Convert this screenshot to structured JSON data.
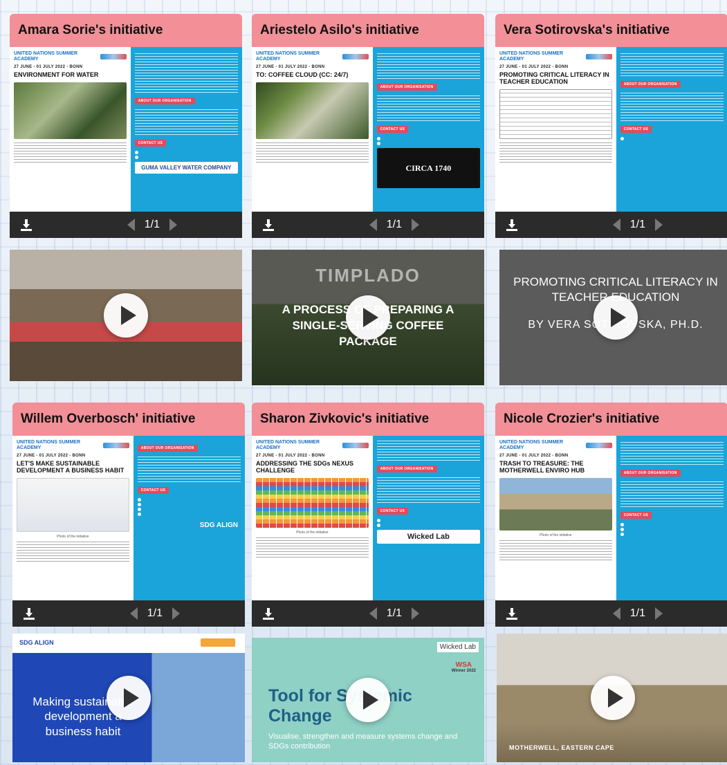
{
  "common": {
    "un_logo": "UNITED NATIONS\nSUMMER ACADEMY",
    "date": "27 JUNE - 01 JULY 2022 - BONN",
    "about_label": "ABOUT OUR ORGANISATION",
    "contact_label": "CONTACT US",
    "photo_caption": "Photo of the initiative",
    "pager_text": "1/1"
  },
  "cards": [
    {
      "title": "Amara Sorie's initiative",
      "heading": "ENVIRONMENT FOR WATER",
      "sponsor": "GUMA VALLEY WATER COMPANY",
      "video_title": "",
      "video_subtitle": ""
    },
    {
      "title": "Ariestelo Asilo's initiative",
      "heading": "TO: COFFEE CLOUD (CC: 24/7)",
      "sponsor": "CIRCA 1740",
      "video_title": "TIMPLADO",
      "video_subtitle": "A PROCESS OF PREPARING A SINGLE-SERVING COFFEE PACKAGE"
    },
    {
      "title": "Vera Sotirovska's initiative",
      "heading": "PROMOTING CRITICAL LITERACY IN TEACHER EDUCATION",
      "sponsor": "",
      "video_title": "PROMOTING CRITICAL LITERACY IN TEACHER EDUCATION",
      "video_subtitle": "BY VERA SOTIROVSKA, PH.D."
    },
    {
      "title": "Willem Overbosch' initiative",
      "heading": "LET'S MAKE SUSTAINABLE DEVELOPMENT A BUSINESS HABIT",
      "sponsor": "SDG ALIGN",
      "video_title": "Making sustainable development a business habit",
      "video_subtitle": "SDG ALIGN"
    },
    {
      "title": "Sharon Zivkovic's initiative",
      "heading": "ADDRESSING THE SDGs NEXUS CHALLENGE",
      "sponsor": "Wicked Lab",
      "video_title": "Tool for Systemic Change",
      "video_subtitle": "Visualise, strengthen and measure systems change and SDGs contribution"
    },
    {
      "title": "Nicole Crozier's initiative",
      "heading": "TRASH TO TREASURE: THE MOTHERWELL ENVIRO HUB",
      "sponsor": "",
      "video_title": "",
      "video_subtitle": "MOTHERWELL, EASTERN CAPE"
    }
  ],
  "wicked_lab_badge": "Wicked Lab",
  "wsa_badge": "WSA",
  "wsa_winner": "Winner 2022"
}
